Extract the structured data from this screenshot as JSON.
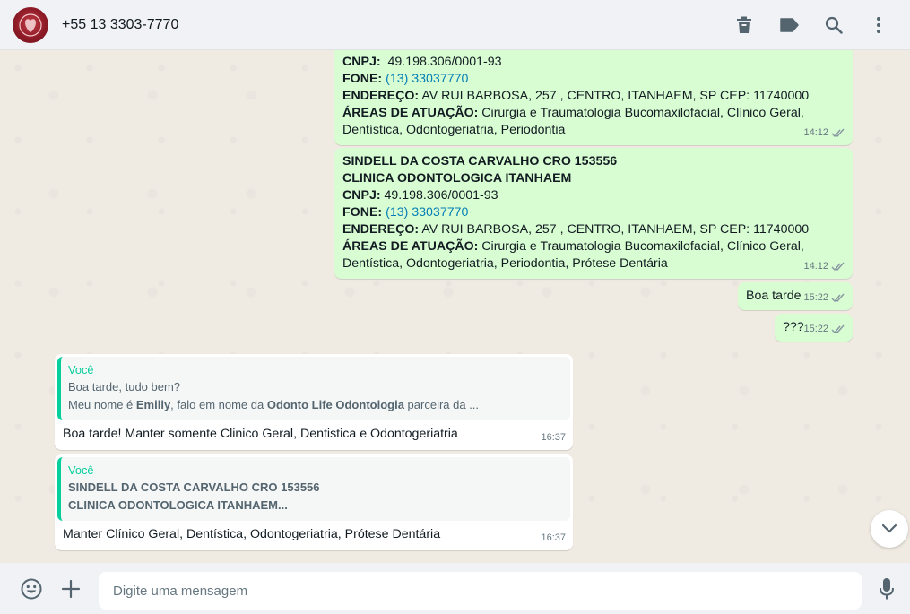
{
  "header": {
    "contact": "+55 13 3303-7770",
    "icons": [
      "avatar",
      "delete-icon",
      "label-icon",
      "search-icon",
      "menu-icon"
    ]
  },
  "messages": {
    "m1": {
      "cnpj_label": "CNPJ:",
      "cnpj_value": "49.198.306/0001-93",
      "fone_label": "FONE:",
      "fone_value": "(13) 33037770",
      "end_label": "ENDEREÇO:",
      "end_value": "AV RUI BARBOSA, 257 , CENTRO, ITANHAEM, SP CEP: 11740000",
      "areas_label": "ÁREAS DE ATUAÇÃO:",
      "areas_value1": "Cirurgia e Traumatologia Bucomaxilofacial, Clínico Geral,",
      "areas_value2": "Dentística, Odontogeriatria, Periodontia",
      "time": "14:12"
    },
    "m2": {
      "title1": "SINDELL DA COSTA CARVALHO CRO 153556",
      "title2": "CLINICA ODONTOLOGICA ITANHAEM",
      "cnpj_label": "CNPJ:",
      "cnpj_value": "49.198.306/0001-93",
      "fone_label": "FONE:",
      "fone_value": "(13) 33037770",
      "end_label": "ENDEREÇO:",
      "end_value": "AV RUI BARBOSA, 257 , CENTRO, ITANHAEM, SP CEP: 11740000",
      "areas_label": "ÁREAS DE ATUAÇÃO:",
      "areas_value1": "Cirurgia e Traumatologia Bucomaxilofacial, Clínico Geral,",
      "areas_value2": "Dentística, Odontogeriatria, Periodontia, Prótese Dentária",
      "time": "14:12"
    },
    "m3": {
      "text": "Boa tarde",
      "time": "15:22"
    },
    "m4": {
      "text": "???",
      "time": "15:22"
    },
    "m5": {
      "quote_author": "Você",
      "quote_line1": "Boa tarde, tudo bem?",
      "quote_line2_a": "Meu nome é ",
      "quote_line2_b": "Emilly",
      "quote_line2_c": ", falo em nome da ",
      "quote_line2_d": "Odonto Life Odontologia",
      "quote_line2_e": " parceira da ...",
      "text": "Boa tarde! Manter somente Clinico Geral, Dentistica e Odontogeriatria",
      "time": "16:37"
    },
    "m6": {
      "quote_author": "Você",
      "quote_line1": "SINDELL DA COSTA CARVALHO CRO 153556",
      "quote_line2": "CLINICA ODONTOLOGICA ITANHAEM...",
      "text": "Manter Clínico Geral, Dentística, Odontogeriatria, Prótese Dentária",
      "time": "16:37"
    }
  },
  "composer": {
    "placeholder": "Digite uma mensagem",
    "icons": [
      "emoji-icon",
      "attach-icon",
      "microphone-icon"
    ]
  },
  "colors": {
    "outgoing": "#d9fdd3",
    "incoming": "#ffffff",
    "quote_accent": "#06cf9c",
    "link": "#027eb5",
    "read_ticks": "#8696a0"
  }
}
